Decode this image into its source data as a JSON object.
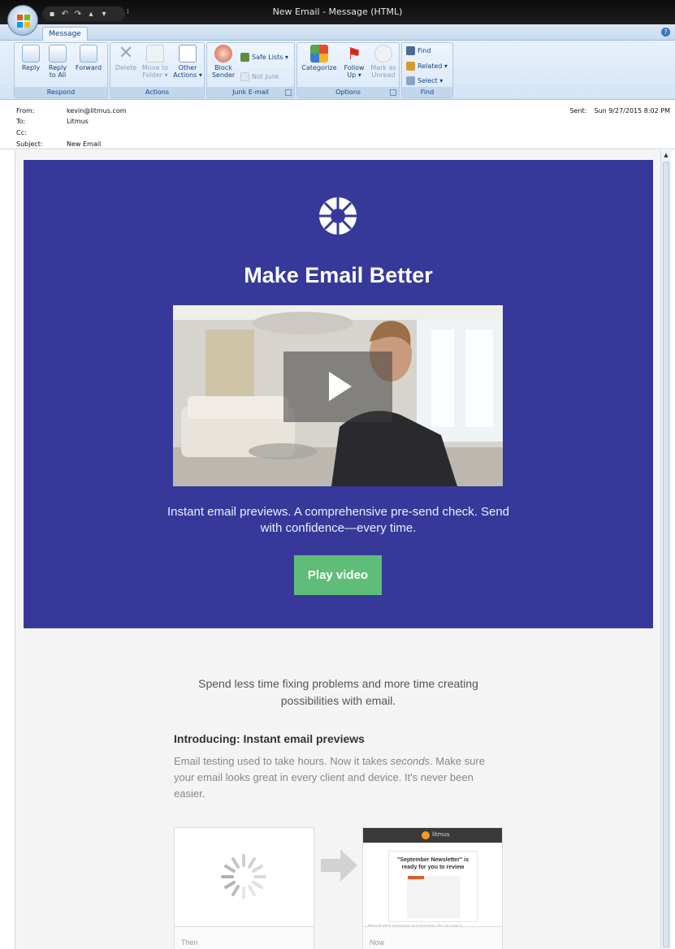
{
  "window": {
    "title": "New Email - Message (HTML)"
  },
  "ribbon": {
    "tab": "Message",
    "groups": {
      "respond": {
        "label": "Respond",
        "reply": "Reply",
        "reply_all": "Reply to All",
        "forward": "Forward"
      },
      "actions": {
        "label": "Actions",
        "delete": "Delete",
        "move_to_folder": "Move to Folder ▾",
        "other_actions": "Other Actions ▾"
      },
      "junk": {
        "label": "Junk E-mail",
        "block_sender": "Block Sender",
        "safe_lists": "Safe Lists ▾",
        "not_junk": "Not Junk"
      },
      "options": {
        "label": "Options",
        "categorize": "Categorize",
        "follow_up": "Follow Up ▾",
        "mark_as_unread": "Mark as Unread"
      },
      "find": {
        "label": "Find",
        "find": "Find",
        "related": "Related ▾",
        "select": "Select ▾"
      }
    }
  },
  "header": {
    "from_label": "From:",
    "from": "kevin@litmus.com",
    "to_label": "To:",
    "to": "Litmus",
    "cc_label": "Cc:",
    "cc": "",
    "subject_label": "Subject:",
    "subject": "New Email",
    "sent_label": "Sent:",
    "sent": "Sun 9/27/2015 8:02 PM"
  },
  "email": {
    "hero_title": "Make Email Better",
    "hero_text": "Instant email previews. A comprehensive pre-send check. Send with confidence—every time.",
    "play_button": "Play video",
    "tagline": "Spend less time fixing problems and more time creating possibilities with email.",
    "intro_heading": "Introducing: Instant email previews",
    "intro_text_before": "Email testing used to take hours. Now it takes ",
    "intro_text_em": "seconds",
    "intro_text_after": ". Make sure your email looks great in every client and device. It's never been easier.",
    "card_then": "Then",
    "card_now": "Now",
    "now_brand": "litmus",
    "now_headline": "\"September Newsletter\" is ready for you to review",
    "now_foot": "We're finished processing your test email. You can view it."
  },
  "colors": {
    "hero_bg": "#36399a",
    "button_green": "#5fbd79",
    "ribbon_text": "#15428b"
  }
}
